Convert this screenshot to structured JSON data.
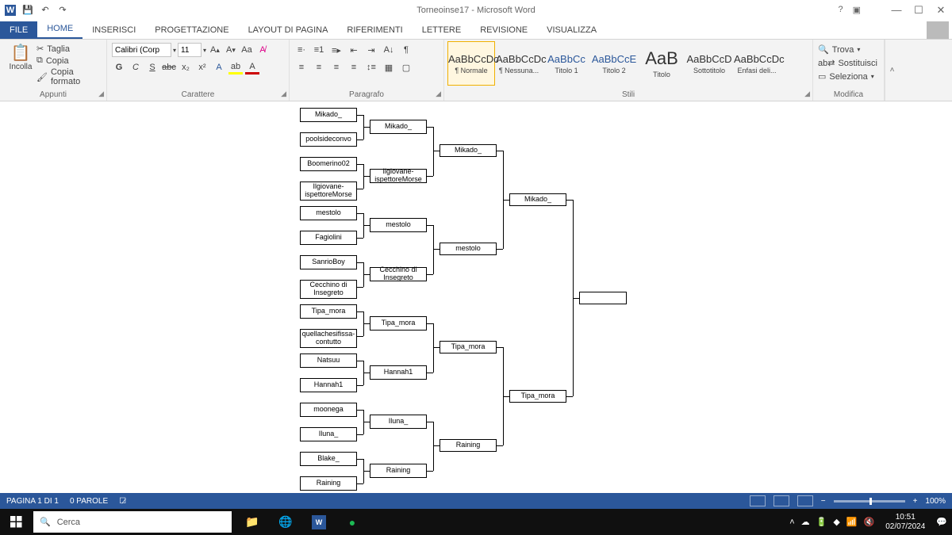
{
  "titlebar": {
    "title": "Torneoinse17 - Microsoft Word"
  },
  "tabs": {
    "file": "FILE",
    "home": "HOME",
    "inserisci": "INSERISCI",
    "progettazione": "PROGETTAZIONE",
    "layout": "LAYOUT DI PAGINA",
    "riferimenti": "RIFERIMENTI",
    "lettere": "LETTERE",
    "revisione": "REVISIONE",
    "visualizza": "VISUALIZZA"
  },
  "clipboard": {
    "paste": "Incolla",
    "cut": "Taglia",
    "copy": "Copia",
    "format": "Copia formato",
    "label": "Appunti"
  },
  "font": {
    "name": "Calibri (Corp",
    "size": "11",
    "label": "Carattere"
  },
  "paragraph": {
    "label": "Paragrafo"
  },
  "styles": {
    "label": "Stili",
    "items": [
      {
        "sample": "AaBbCcDc",
        "name": "¶ Normale",
        "cls": ""
      },
      {
        "sample": "AaBbCcDc",
        "name": "¶ Nessuna...",
        "cls": ""
      },
      {
        "sample": "AaBbCc",
        "name": "Titolo 1",
        "cls": "blue"
      },
      {
        "sample": "AaBbCcE",
        "name": "Titolo 2",
        "cls": "blue"
      },
      {
        "sample": "AaB",
        "name": "Titolo",
        "cls": "big"
      },
      {
        "sample": "AaBbCcD",
        "name": "Sottotitolo",
        "cls": ""
      },
      {
        "sample": "AaBbCcDc",
        "name": "Enfasi deli...",
        "cls": ""
      }
    ]
  },
  "editing": {
    "find": "Trova",
    "replace": "Sostituisci",
    "select": "Seleziona",
    "label": "Modifica"
  },
  "bracket": {
    "r1": [
      "Mikado_",
      "poolsideconvo",
      "Boomerino02",
      "Ilgiovane-\nispettoreMorse",
      "mestolo",
      "Fagiolini",
      "SanrioBoy",
      "Cecchino di\nInsegreto",
      "Tipa_mora",
      "quellachesifissa-\ncontutto",
      "Natsuu",
      "Hannah1",
      "moonega",
      "Iluna_",
      "Blake_",
      "Raining"
    ],
    "r2": [
      "Mikado_",
      "Ilgiovane-\nispettoreMorse",
      "mestolo",
      "Cecchino di\nInsegreto",
      "Tipa_mora",
      "Hannah1",
      "Iluna_",
      "Raining"
    ],
    "r3": [
      "Mikado_",
      "mestolo",
      "Tipa_mora",
      "Raining"
    ],
    "r4": [
      "Mikado_",
      "Tipa_mora"
    ],
    "r5": [
      ""
    ]
  },
  "statusbar": {
    "page": "PAGINA 1 DI 1",
    "words": "0 PAROLE",
    "zoom": "100%"
  },
  "taskbar": {
    "search": "Cerca",
    "time": "10:51",
    "date": "02/07/2024"
  }
}
